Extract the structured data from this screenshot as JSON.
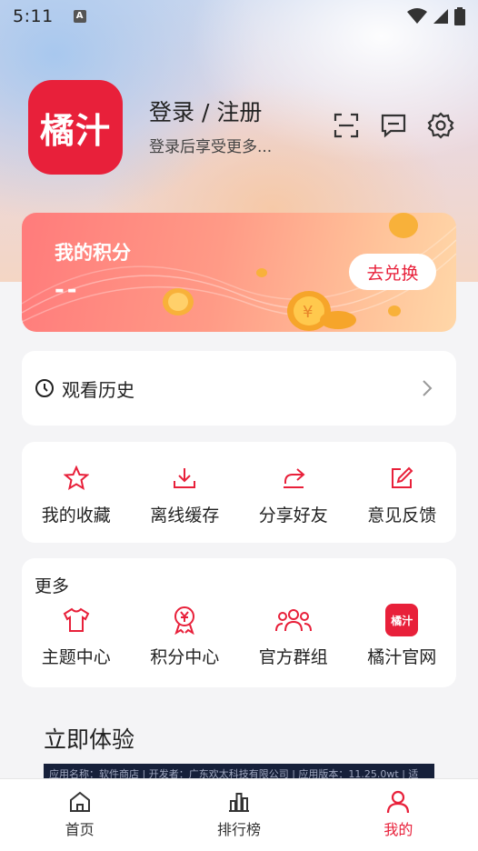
{
  "status_bar": {
    "time": "5:11",
    "notif_glyph": "A",
    "icons": [
      "wifi-icon",
      "signal-icon",
      "battery-icon"
    ]
  },
  "profile": {
    "logo_text": "橘汁",
    "login_title": "登录 / 注册",
    "login_subtitle": "登录后享受更多..."
  },
  "header_icons": [
    "scan-icon",
    "message-icon",
    "settings-icon"
  ],
  "points": {
    "title": "我的积分",
    "value": "--",
    "redeem_label": "去兑换"
  },
  "history": {
    "label": "观看历史"
  },
  "quick_actions": [
    {
      "label": "我的收藏",
      "icon": "star-icon"
    },
    {
      "label": "离线缓存",
      "icon": "download-icon"
    },
    {
      "label": "分享好友",
      "icon": "share-icon"
    },
    {
      "label": "意见反馈",
      "icon": "edit-icon"
    }
  ],
  "more": {
    "title": "更多",
    "items": [
      {
        "label": "主题中心",
        "icon": "tshirt-icon"
      },
      {
        "label": "积分中心",
        "icon": "yuan-badge-icon"
      },
      {
        "label": "官方群组",
        "icon": "group-icon"
      },
      {
        "label": "橘汁官网",
        "icon": "brand-logo-icon",
        "logo_text": "橘汁"
      }
    ]
  },
  "try_now": {
    "title": "立即体验",
    "banner_text": "应用名称：软件商店 | 开发者：广东欢太科技有限公司 | 应用版本：11.25.0wt | 适"
  },
  "bottom_nav": [
    {
      "label": "首页",
      "icon": "home-icon",
      "active": false
    },
    {
      "label": "排行榜",
      "icon": "chart-icon",
      "active": false
    },
    {
      "label": "我的",
      "icon": "user-icon",
      "active": true
    }
  ],
  "colors": {
    "brand": "#e8203a",
    "background": "#f4f4f6"
  }
}
